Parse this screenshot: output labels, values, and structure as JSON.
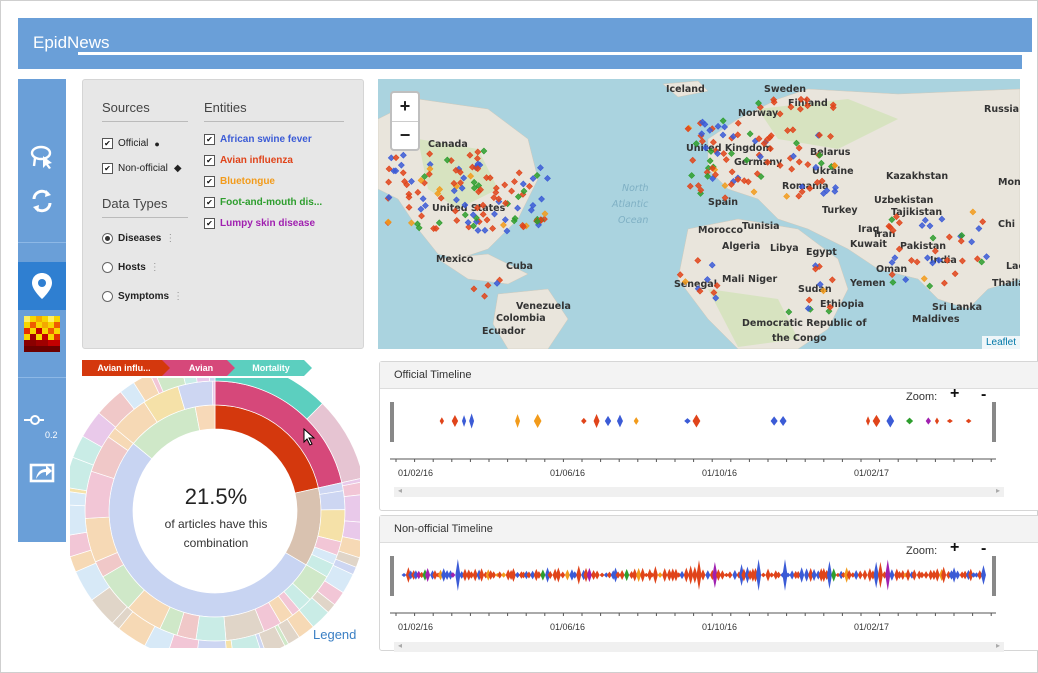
{
  "app": {
    "title": "EpidNews"
  },
  "sidebar": {
    "slider_value": "0.2"
  },
  "filters": {
    "sources_heading": "Sources",
    "entities_heading": "Entities",
    "data_types_heading": "Data Types",
    "sources": [
      {
        "label": "Official",
        "checked": true,
        "marker": "●"
      },
      {
        "label": "Non-official",
        "checked": true,
        "marker": "◆"
      }
    ],
    "entities": [
      {
        "label": "African swine fever",
        "color": "#3b5bd6"
      },
      {
        "label": "Avian influenza",
        "color": "#e0441a"
      },
      {
        "label": "Bluetongue",
        "color": "#f29b1b"
      },
      {
        "label": "Foot-and-mouth dis...",
        "color": "#2e9e2e"
      },
      {
        "label": "Lumpy skin disease",
        "color": "#a020b0"
      }
    ],
    "data_types": [
      {
        "label": "Diseases",
        "selected": true
      },
      {
        "label": "Hosts",
        "selected": false
      },
      {
        "label": "Symptoms",
        "selected": false
      }
    ]
  },
  "map": {
    "zoom_in": "+",
    "zoom_out": "−",
    "attribution": "Leaflet",
    "labels": [
      "Iceland",
      "Sweden",
      "Finland",
      "Norway",
      "Russia",
      "Canada",
      "United Kingdom",
      "Belarus",
      "Ukraine",
      "Germany",
      "Romania",
      "Kazakhstan",
      "Mong",
      "Spain",
      "Turkey",
      "Uzbekistan",
      "Tajikistan",
      "United States",
      "North",
      "Atlantic",
      "Ocean",
      "Morocco",
      "Tunisia",
      "Iraq",
      "Iran",
      "Chi",
      "Algeria",
      "Libya",
      "Egypt",
      "Kuwait",
      "Pakistan",
      "Mexico",
      "Cuba",
      "Oman",
      "Senegal",
      "Mali",
      "Niger",
      "Sudan",
      "Yemen",
      "Ethiopia",
      "Sri Lanka",
      "Venezuela",
      "Colombia",
      "Ecuador",
      "Maldives",
      "Democratic Republic of",
      "the Congo",
      "India",
      "Lao",
      "Thaila"
    ]
  },
  "breadcrumb": [
    "Avian influ...",
    "Avian",
    "Mortality"
  ],
  "sunburst": {
    "percent": "21.5%",
    "caption_line1": "of articles have this",
    "caption_line2": "combination",
    "legend_label": "Legend"
  },
  "timelines": [
    {
      "title": "Official Timeline",
      "zoom_label": "Zoom:",
      "zoom_in": "+",
      "zoom_out": "-",
      "ticks": [
        "01/02/16",
        "01/06/16",
        "01/10/16",
        "01/02/17"
      ]
    },
    {
      "title": "Non-official Timeline",
      "zoom_label": "Zoom:",
      "zoom_in": "+",
      "zoom_out": "-",
      "ticks": [
        "01/02/16",
        "01/06/16",
        "01/10/16",
        "01/02/17"
      ]
    }
  ],
  "colors": {
    "header": "#6a9fd8",
    "sidebar_active": "#2f7fd1",
    "crumb_1": "#d4380d",
    "crumb_2": "#d6487a",
    "crumb_3": "#5ccfbf"
  }
}
